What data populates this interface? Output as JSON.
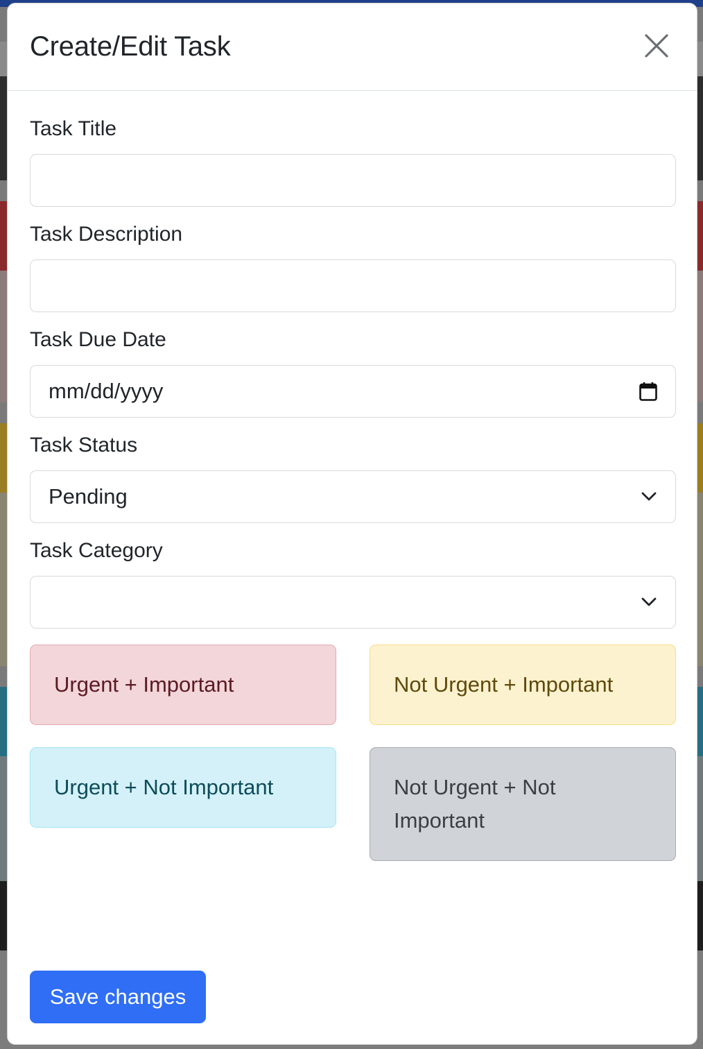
{
  "modal": {
    "title": "Create/Edit Task"
  },
  "form": {
    "title_label": "Task Title",
    "title_value": "",
    "description_label": "Task Description",
    "description_value": "",
    "due_date_label": "Task Due Date",
    "due_date_placeholder": "mm/dd/yyyy",
    "status_label": "Task Status",
    "status_selected": "Pending",
    "category_label": "Task Category",
    "category_selected": ""
  },
  "priorities": [
    {
      "label": "Urgent + Important",
      "color": "#f2d6d9"
    },
    {
      "label": "Not Urgent + Important",
      "color": "#fdf2cf"
    },
    {
      "label": "Urgent + Not Important",
      "color": "#d4f1f9"
    },
    {
      "label": "Not Urgent + Not Important",
      "color": "#d0d4d8"
    }
  ],
  "actions": {
    "save_label": "Save changes"
  },
  "icons": {
    "close": "close-icon",
    "calendar": "calendar-icon",
    "dropdown": "chevron-down-icon"
  },
  "colors": {
    "primary": "#2f6ef5"
  }
}
